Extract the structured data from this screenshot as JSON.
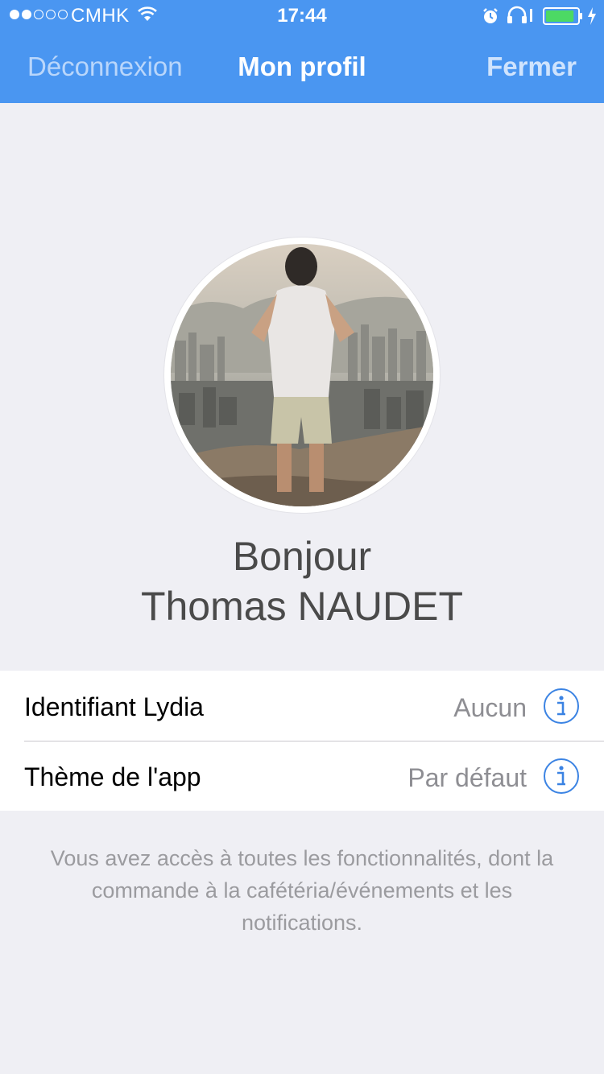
{
  "status_bar": {
    "carrier": "CMHK",
    "time": "17:44",
    "signal_bars_filled": 2,
    "signal_bars_total": 5,
    "battery_level": 0.9
  },
  "nav": {
    "left_label": "Déconnexion",
    "title": "Mon profil",
    "right_label": "Fermer"
  },
  "profile": {
    "greeting": "Bonjour",
    "name": "Thomas NAUDET"
  },
  "settings": [
    {
      "label": "Identifiant Lydia",
      "value": "Aucun",
      "icon": "info-icon"
    },
    {
      "label": "Thème de l'app",
      "value": "Par défaut",
      "icon": "info-icon"
    }
  ],
  "footer_note": "Vous avez accès à toutes les fonctionnalités, dont la commande à la cafétéria/événements et les notifications.",
  "colors": {
    "accent": "#4a96f1",
    "background": "#efeff4",
    "info_icon": "#3b83e3"
  }
}
